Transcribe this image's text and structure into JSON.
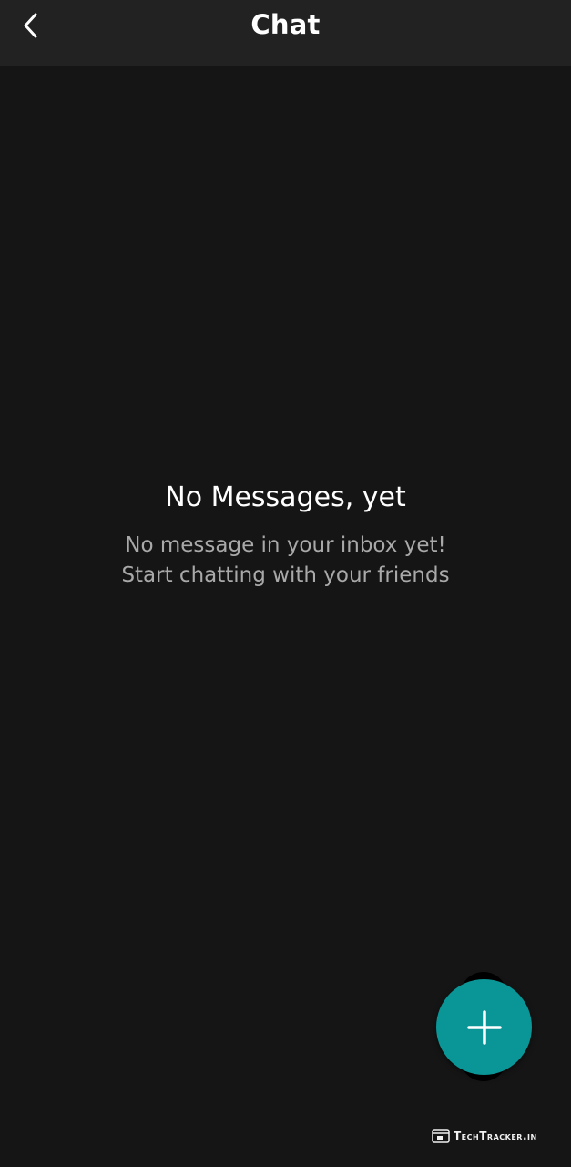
{
  "header": {
    "title": "Chat",
    "back_icon": "chevron-left-icon"
  },
  "empty_state": {
    "heading": "No Messages, yet",
    "line1": "No message in your inbox yet!",
    "line2": "Start chatting with your friends"
  },
  "fab": {
    "icon": "plus-icon",
    "color": "#0a9596"
  },
  "watermark": {
    "text": "TechTracker.in"
  },
  "colors": {
    "background": "#151515",
    "topbar": "#222222",
    "accent": "#0a9596"
  }
}
